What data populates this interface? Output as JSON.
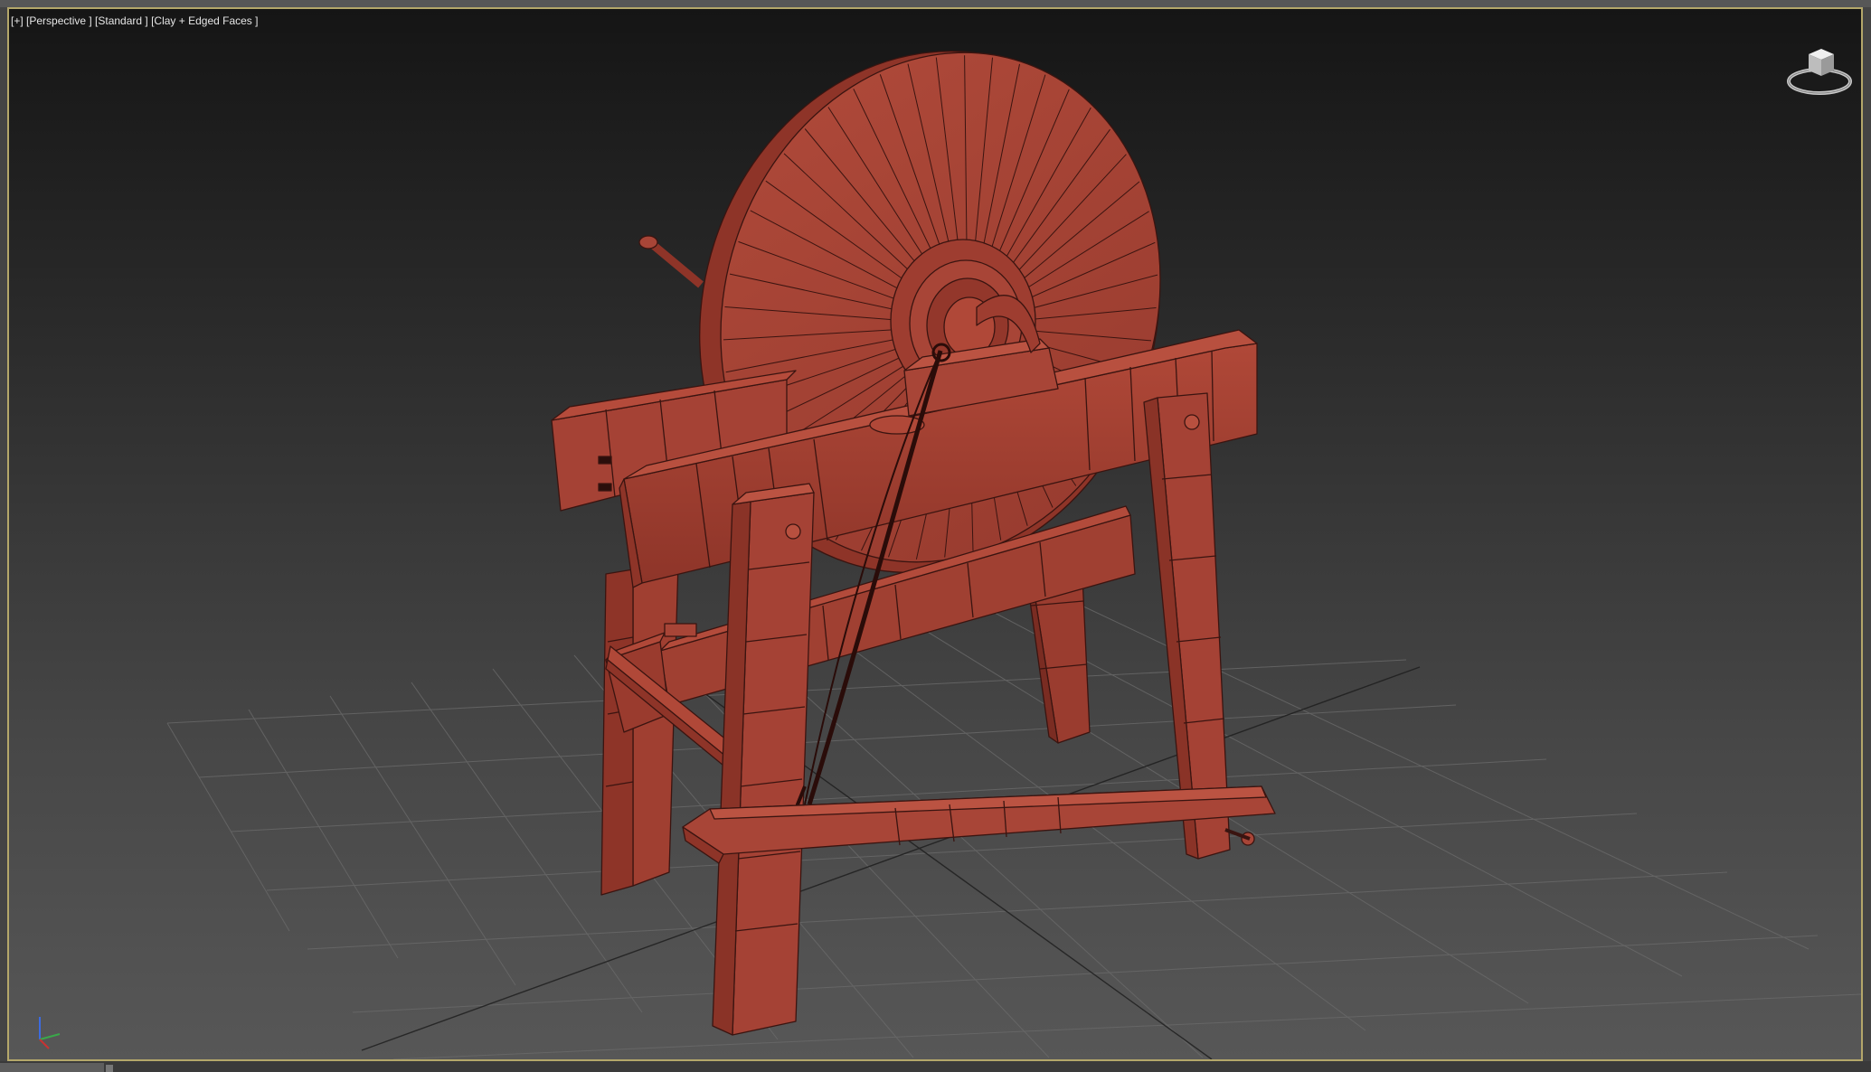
{
  "viewport": {
    "label": "[+] [Perspective ] [Standard ] [Clay + Edged Faces ]",
    "border_color": "#b4a76a",
    "background_top": "#151515",
    "background_bottom": "#575757"
  },
  "model": {
    "material_color": "#a13f32",
    "edge_color": "#3a1410"
  },
  "icons": {
    "viewcube": "viewcube-icon",
    "axis_tripod": "axis-tripod-icon"
  }
}
